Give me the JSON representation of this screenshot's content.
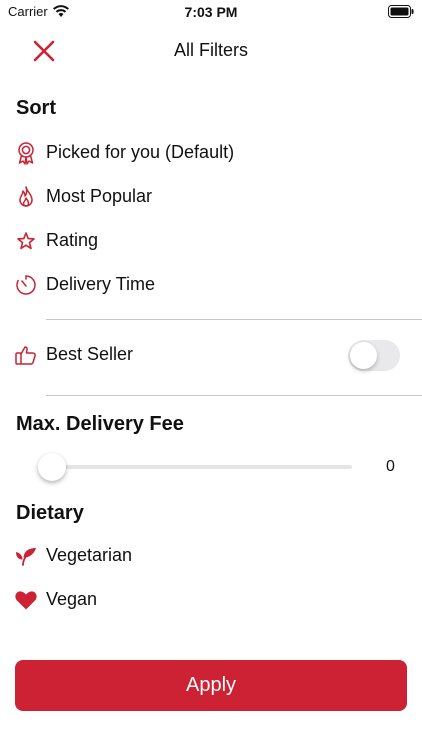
{
  "status_bar": {
    "carrier": "Carrier",
    "time": "7:03 PM"
  },
  "header": {
    "title": "All Filters"
  },
  "sort": {
    "title": "Sort",
    "options": [
      {
        "label": "Picked for you (Default)",
        "icon": "award-ribbon-icon"
      },
      {
        "label": "Most Popular",
        "icon": "flame-icon"
      },
      {
        "label": "Rating",
        "icon": "star-icon"
      },
      {
        "label": "Delivery Time",
        "icon": "clock-timer-icon"
      }
    ]
  },
  "best_seller": {
    "label": "Best Seller",
    "icon": "thumbs-up-icon",
    "enabled": false
  },
  "delivery_fee": {
    "title": "Max. Delivery Fee",
    "value": "0"
  },
  "dietary": {
    "title": "Dietary",
    "options": [
      {
        "label": "Vegetarian",
        "icon": "leaf-icon"
      },
      {
        "label": "Vegan",
        "icon": "heart-icon"
      }
    ]
  },
  "apply_label": "Apply",
  "colors": {
    "accent": "#cc2233"
  }
}
